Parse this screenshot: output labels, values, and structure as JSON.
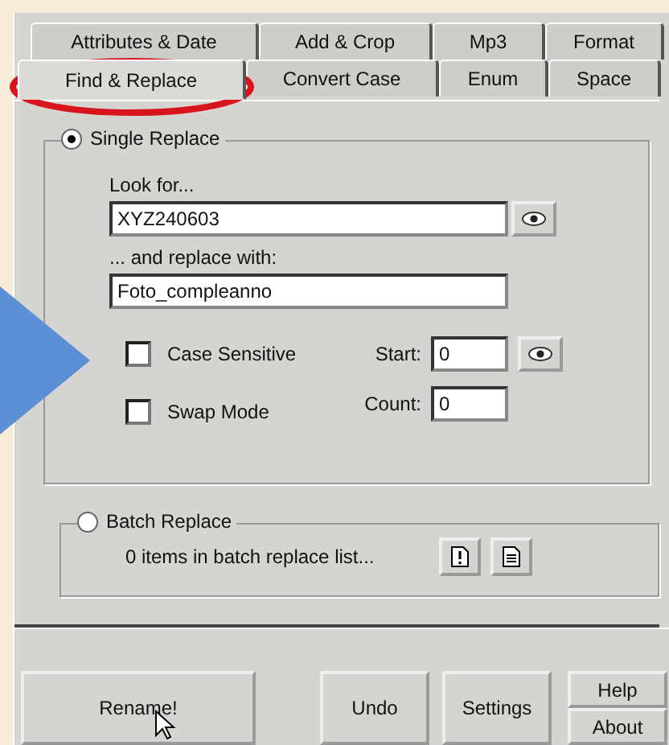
{
  "tab_rows": [
    [
      {
        "label": "Attributes & Date",
        "selected": false
      },
      {
        "label": "Add & Crop",
        "selected": false
      },
      {
        "label": "Mp3",
        "selected": false
      },
      {
        "label": "Format",
        "selected": false
      }
    ],
    [
      {
        "label": "Find & Replace",
        "selected": true
      },
      {
        "label": "Convert Case",
        "selected": false
      },
      {
        "label": "Enum",
        "selected": false
      },
      {
        "label": "Space",
        "selected": false
      }
    ]
  ],
  "single_replace": {
    "label": "Single Replace",
    "selected": true,
    "look_for": {
      "label": "Look for...",
      "value": "XYZ240603"
    },
    "replace_with": {
      "label": "... and replace with:",
      "value": "Foto_compleanno"
    },
    "options": [
      {
        "label": "Case Sensitive",
        "checked": false
      },
      {
        "label": "Swap Mode",
        "checked": false
      }
    ],
    "start": {
      "label": "Start:",
      "value": "0"
    },
    "count": {
      "label": "Count:",
      "value": "0"
    }
  },
  "batch_replace": {
    "label": "Batch Replace",
    "selected": false,
    "status": "0 items in batch replace list..."
  },
  "buttons": [
    {
      "label": "Rename!",
      "kind": "main"
    },
    {
      "label": "Undo",
      "kind": "normal"
    },
    {
      "label": "Settings",
      "kind": "normal"
    },
    {
      "label": "Help",
      "kind": "stack"
    },
    {
      "label": "About",
      "kind": "stack"
    }
  ]
}
